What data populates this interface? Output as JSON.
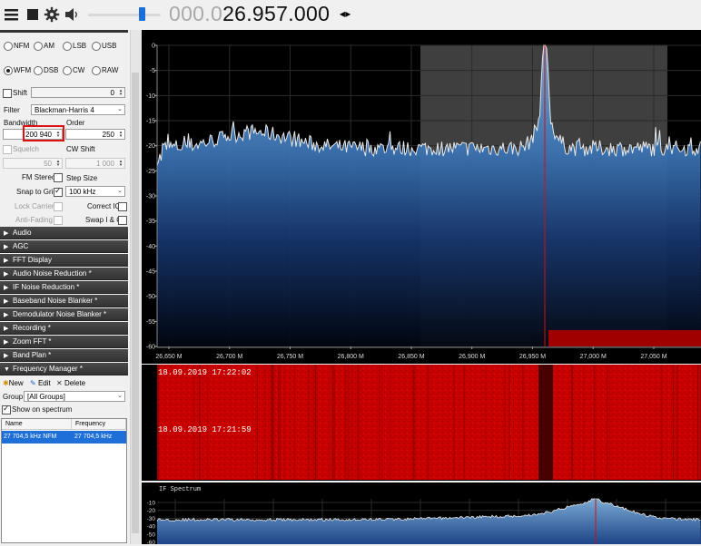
{
  "toolbar": {
    "menu_icon": "hamburger-menu-icon",
    "stop_icon": "stop-icon",
    "settings_icon": "gear-icon",
    "volume_icon": "speaker-icon",
    "frequency_dim": "000.0",
    "frequency_bright": "26.957.000",
    "tune_icon": "left-right-arrows-icon"
  },
  "modes": {
    "row1": [
      "NFM",
      "AM",
      "LSB",
      "USB"
    ],
    "row2": [
      "WFM",
      "DSB",
      "CW",
      "RAW"
    ],
    "selected": "WFM"
  },
  "demod": {
    "shift_label": "Shift",
    "shift_value": "0",
    "filter_label": "Filter",
    "filter_value": "Blackman-Harris 4",
    "bandwidth_label": "Bandwidth",
    "bandwidth_value": "200 940",
    "order_label": "Order",
    "order_value": "250",
    "squelch_label": "Squelch",
    "squelch_value": "50",
    "cw_shift_label": "CW Shift",
    "cw_shift_value": "1 000",
    "fm_stereo_label": "FM Stereo",
    "step_size_label": "Step Size",
    "snap_to_grid_label": "Snap to Grid",
    "step_value": "100 kHz",
    "lock_carrier_label": "Lock Carrier",
    "correct_iq_label": "Correct IQ",
    "anti_fading_label": "Anti-Fading",
    "swap_iq_label": "Swap I & Q"
  },
  "sections": [
    "Audio",
    "AGC",
    "FFT Display",
    "Audio Noise Reduction *",
    "IF Noise Reduction *",
    "Baseband Noise Blanker *",
    "Demodulator Noise Blanker *",
    "Recording *",
    "Zoom FFT *",
    "Band Plan *",
    "Frequency Manager *"
  ],
  "freq_manager": {
    "new_label": "New",
    "edit_label": "Edit",
    "delete_label": "Delete",
    "group_label": "Group:",
    "group_value": "[All Groups]",
    "show_on_spectrum_label": "Show on spectrum",
    "columns": [
      "Name",
      "Frequency"
    ],
    "rows": [
      {
        "name": "27 704,5 kHz NFM",
        "frequency": "27 704,5 kHz"
      }
    ]
  },
  "spectrum": {
    "y_ticks": [
      "0",
      "-5",
      "-10",
      "-15",
      "-20",
      "-25",
      "-30",
      "-35",
      "-40",
      "-45",
      "-50",
      "-55",
      "-60"
    ],
    "x_ticks": [
      "26,650 M",
      "26,700 M",
      "26,750 M",
      "26,800 M",
      "26,850 M",
      "26,900 M",
      "26,950 M",
      "27,000 M",
      "27,050 M"
    ],
    "colors": {
      "filter_band": "#4a4a4a",
      "center_line": "#d01010",
      "trace": "#e6e6e6",
      "fill_top": "#6fa3cf",
      "fill_bottom": "#000"
    }
  },
  "waterfall": {
    "timestamps": [
      "18.09.2019 17:22:02",
      "18.09.2019 17:21:59"
    ],
    "color": "#c00000"
  },
  "if_spectrum": {
    "title": "IF Spectrum",
    "y_ticks": [
      "-10",
      "-20",
      "-30",
      "-40",
      "-50",
      "-60"
    ]
  }
}
